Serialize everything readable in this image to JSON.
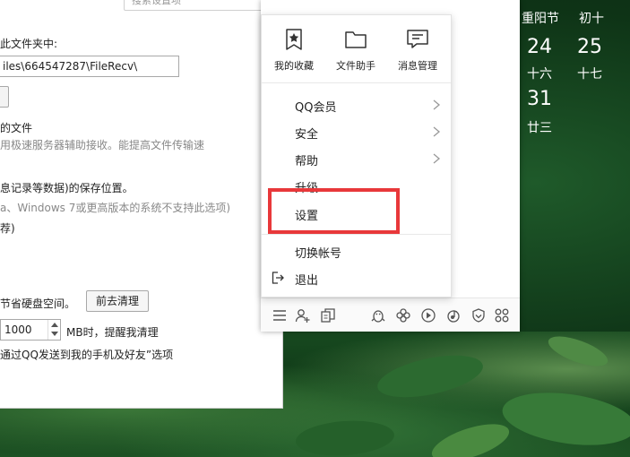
{
  "calendar": {
    "row1": [
      {
        "text": "重阳节"
      },
      {
        "text": "初十"
      }
    ],
    "row2": [
      {
        "day": "24",
        "lunar": "十六"
      },
      {
        "day": "25",
        "lunar": "十七"
      }
    ],
    "row3": [
      {
        "day": "31",
        "lunar": "廿三"
      }
    ]
  },
  "settings": {
    "search_placeholder": "搜索设置项",
    "folder_label": "此文件夹中:",
    "folder_path": "iles\\664547287\\FileRecv\\",
    "file_label": "的文件",
    "accel_note": "用极速服务器辅助接收。能提高文件传输速",
    "storage_note": "息记录等数据)的保存位置。",
    "os_note": "a、Windows 7或更高版本的系统不支持此选项)",
    "save_note": "荐)",
    "disk_note": "节省硬盘空间。",
    "clean_button": "前去清理",
    "size_value": "1000",
    "size_note": "MB时，提醒我清理",
    "send_note": "通过QQ发送到我的手机及好友”选项"
  },
  "menu": {
    "top_items": [
      {
        "label": "我的收藏",
        "icon": "bookmark-star-icon"
      },
      {
        "label": "文件助手",
        "icon": "folder-icon"
      },
      {
        "label": "消息管理",
        "icon": "message-manage-icon"
      }
    ],
    "items": [
      {
        "label": "QQ会员",
        "has_submenu": true
      },
      {
        "label": "安全",
        "has_submenu": true
      },
      {
        "label": "帮助",
        "has_submenu": true
      },
      {
        "label": "升级",
        "has_submenu": false
      },
      {
        "label": "设置",
        "has_submenu": false
      },
      {
        "label": "切换帐号",
        "has_submenu": false
      },
      {
        "label": "退出",
        "has_submenu": false,
        "icon": "logout-icon"
      }
    ]
  },
  "bottom_bar": {
    "icons": [
      "menu-icon",
      "add-contact-icon",
      "apps-icon",
      "penguin-icon",
      "clover-icon",
      "video-play-icon",
      "music-icon",
      "shield-icon",
      "grid-icon"
    ]
  },
  "colors": {
    "highlight": "#e8383a",
    "wallpaper": "#123d1c"
  }
}
